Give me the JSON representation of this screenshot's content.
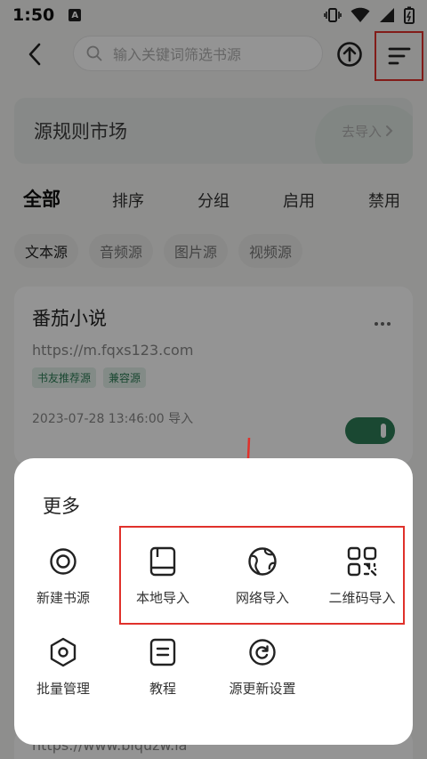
{
  "status_bar": {
    "time": "1:50",
    "notification_letter": "A"
  },
  "header": {
    "search_placeholder": "输入关键词筛选书源"
  },
  "market": {
    "title": "源规则市场",
    "action_label": "去导入"
  },
  "filter_tabs": [
    "全部",
    "排序",
    "分组",
    "启用",
    "禁用"
  ],
  "type_chips": [
    "文本源",
    "音频源",
    "图片源",
    "视频源"
  ],
  "source_card": {
    "name": "番茄小说",
    "url": "https://m.fqxs123.com",
    "tags": [
      "书友推荐源",
      "兼容源"
    ],
    "date": "2023-07-28 13:46:00 导入",
    "enabled": true
  },
  "peek_url": "https://www.biquzw.la",
  "sheet": {
    "title": "更多",
    "items": [
      {
        "label": "新建书源",
        "icon": "target-icon"
      },
      {
        "label": "本地导入",
        "icon": "book-icon"
      },
      {
        "label": "网络导入",
        "icon": "globe-icon"
      },
      {
        "label": "二维码导入",
        "icon": "qr-code-icon"
      },
      {
        "label": "批量管理",
        "icon": "hexagon-settings-icon"
      },
      {
        "label": "教程",
        "icon": "document-icon"
      },
      {
        "label": "源更新设置",
        "icon": "refresh-icon"
      }
    ]
  },
  "colors": {
    "accent_green": "#2e7d57",
    "highlight_red": "#e0312b"
  }
}
